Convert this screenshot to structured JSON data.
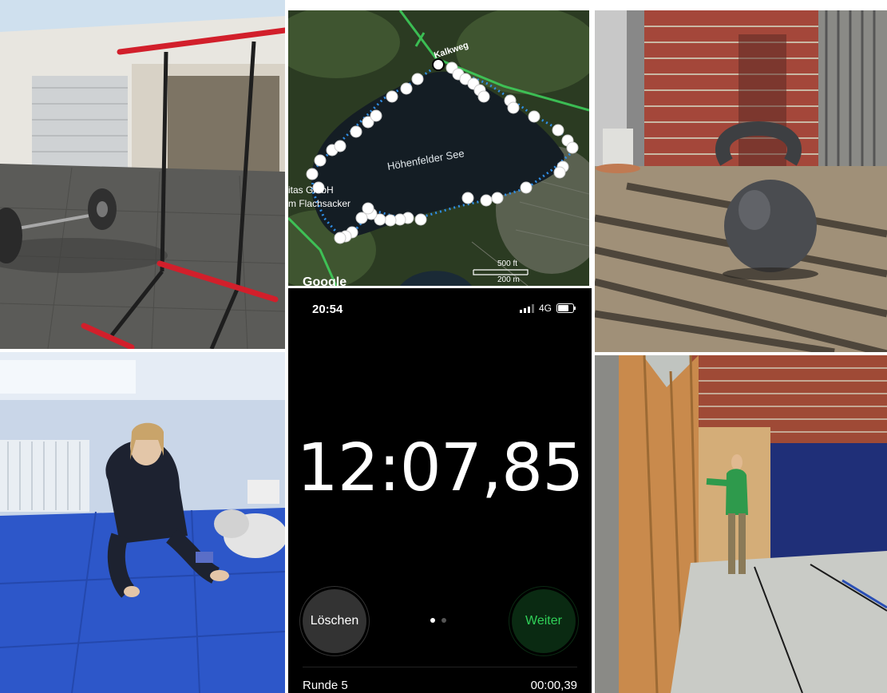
{
  "map": {
    "lake_name": "Höhenfelder See",
    "road_name": "Kalkweg",
    "place_line1": "itas GmbH",
    "place_line2": "m Flachsacker",
    "scale_ft": "500 ft",
    "scale_m": "200 m",
    "logo": "Google"
  },
  "stopwatch": {
    "status_time": "20:54",
    "network": "4G",
    "elapsed": "12:07,85",
    "reset_label": "Löschen",
    "resume_label": "Weiter",
    "lap_label": "Runde 5",
    "lap_time": "00:00,39"
  },
  "colors": {
    "track_dot": "#2f8ee6",
    "resume_green": "#30d158",
    "phone_bg": "#000000"
  }
}
